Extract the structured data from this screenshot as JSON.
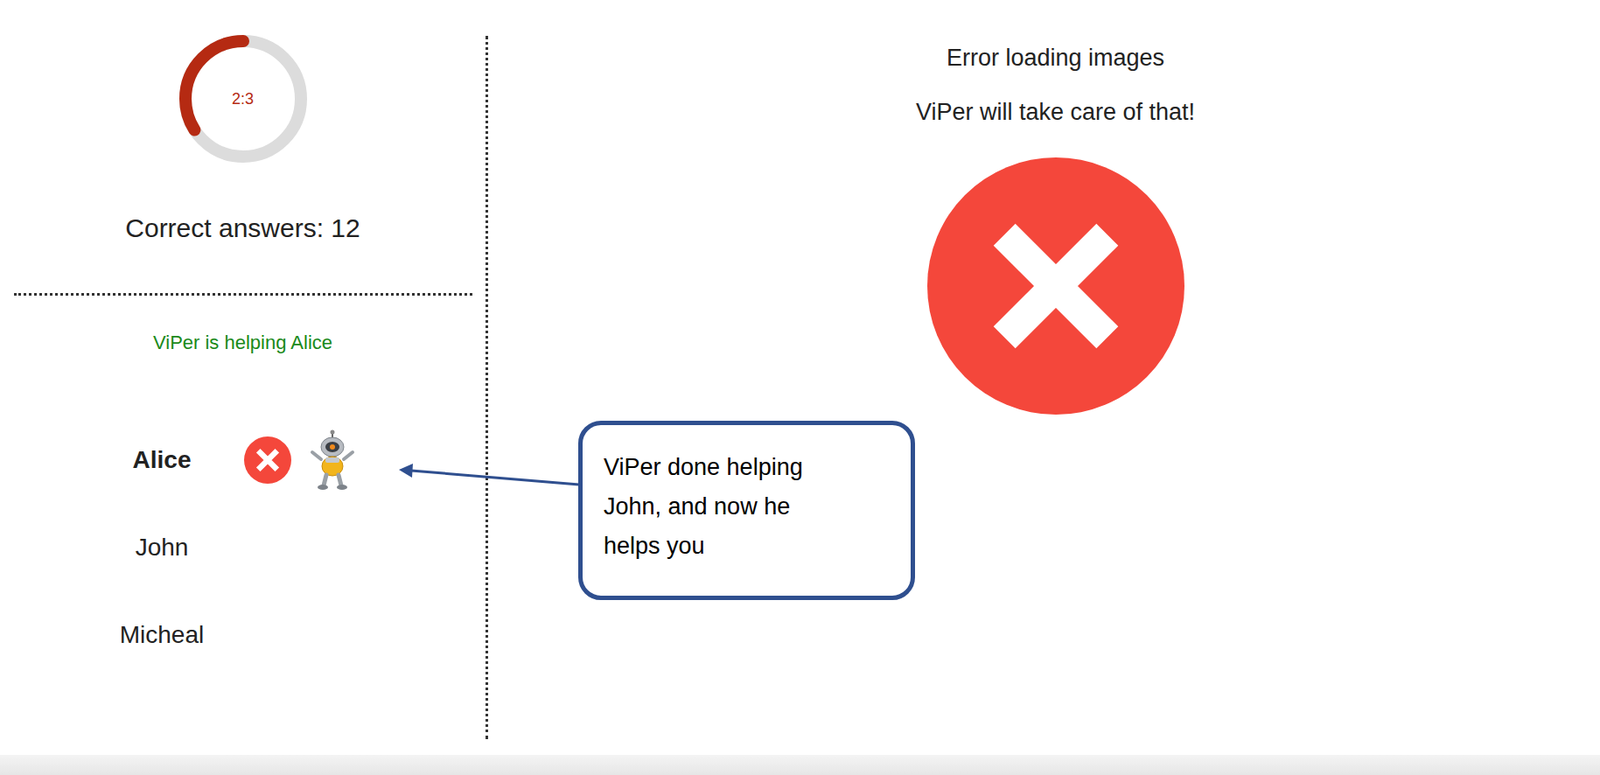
{
  "timer": {
    "reading": "2:3",
    "level": 0.34
  },
  "score": {
    "label": "Correct answers: 12"
  },
  "helper_status": "ViPer is helping Alice",
  "players": [
    {
      "name": "Alice",
      "selected": true,
      "failed": true,
      "helped": true
    },
    {
      "name": "John",
      "selected": false,
      "failed": false,
      "helped": false
    },
    {
      "name": "Micheal",
      "selected": false,
      "failed": false,
      "helped": false
    }
  ],
  "main": {
    "lines": [
      "Error loading images",
      "ViPer will take care of that!"
    ],
    "failed": true
  },
  "callout": {
    "text": "ViPer done helping John, and now he helps you"
  }
}
